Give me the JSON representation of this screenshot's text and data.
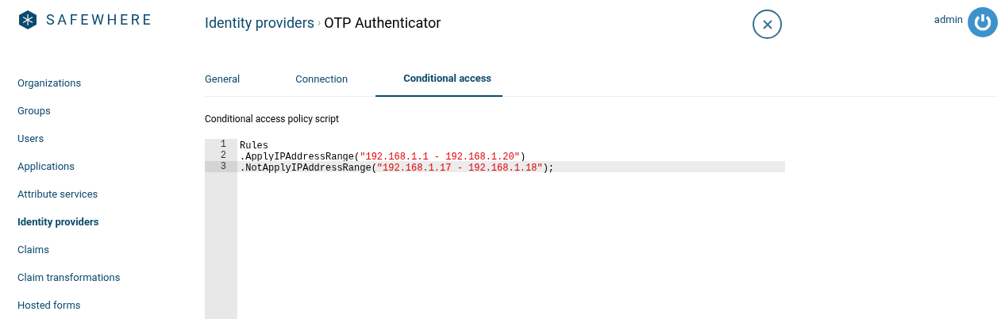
{
  "logo": {
    "text": "SAFEWHERE"
  },
  "breadcrumb": {
    "parent": "Identity providers",
    "separator": "›",
    "current": "OTP Authenticator"
  },
  "user": {
    "name": "admin"
  },
  "sidebar": {
    "items": [
      {
        "label": "Organizations",
        "selected": false
      },
      {
        "label": "Groups",
        "selected": false
      },
      {
        "label": "Users",
        "selected": false
      },
      {
        "label": "Applications",
        "selected": false
      },
      {
        "label": "Attribute services",
        "selected": false
      },
      {
        "label": "Identity providers",
        "selected": true
      },
      {
        "label": "Claims",
        "selected": false
      },
      {
        "label": "Claim transformations",
        "selected": false
      },
      {
        "label": "Hosted forms",
        "selected": false
      }
    ]
  },
  "tabs": [
    {
      "label": "General",
      "selected": false
    },
    {
      "label": "Connection",
      "selected": false
    },
    {
      "label": "Conditional access",
      "selected": true
    }
  ],
  "editor": {
    "label": "Conditional access policy script",
    "lines": [
      {
        "number": "1",
        "selected": false,
        "tokens": [
          {
            "kind": "plain",
            "text": "Rules"
          }
        ]
      },
      {
        "number": "2",
        "selected": false,
        "tokens": [
          {
            "kind": "plain",
            "text": ".ApplyIPAddressRange("
          },
          {
            "kind": "string",
            "text": "\"192.168.1.1 - 192.168.1.20\""
          },
          {
            "kind": "plain",
            "text": ")"
          }
        ]
      },
      {
        "number": "3",
        "selected": true,
        "tokens": [
          {
            "kind": "plain",
            "text": ".NotApplyIPAddressRange("
          },
          {
            "kind": "string",
            "text": "\"192.168.1.17 - 192.168.1.18\""
          },
          {
            "kind": "plain",
            "text": ");"
          }
        ]
      }
    ]
  }
}
